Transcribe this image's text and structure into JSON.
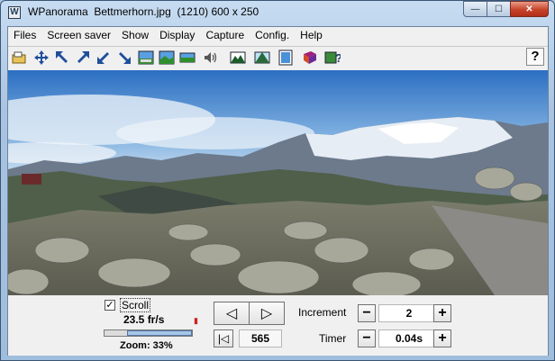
{
  "window": {
    "app_name": "WPanorama",
    "file_name": "Bettmerhorn.jpg",
    "info": "(1210) 600 x 250",
    "buttons": {
      "minimize": "—",
      "maximize": "☐",
      "close": "✕"
    }
  },
  "menu": [
    "Files",
    "Screen saver",
    "Show",
    "Display",
    "Capture",
    "Config.",
    "Help"
  ],
  "toolbar": {
    "icons": [
      "open-icon",
      "move-icon",
      "shrink-top-left-icon",
      "expand-top-right-icon",
      "shrink-bottom-left-icon",
      "expand-bottom-right-icon",
      "picture-fit-icon",
      "picture-green-icon",
      "picture-flat-icon",
      "sound-icon",
      "landscape-icon",
      "mountain-peak-icon",
      "frame-icon",
      "book-icon",
      "help-picture-icon"
    ],
    "help_label": "?"
  },
  "controls": {
    "scroll_label": "Scroll",
    "scroll_checked": "✓",
    "fps": "23.5 fr/s",
    "speed_fraction": 0.74,
    "zoom": "Zoom: 33%",
    "position": "565",
    "increment_label": "Increment",
    "increment_value": "2",
    "timer_label": "Timer",
    "timer_value": "0.04s",
    "minus": "−",
    "plus": "+"
  }
}
